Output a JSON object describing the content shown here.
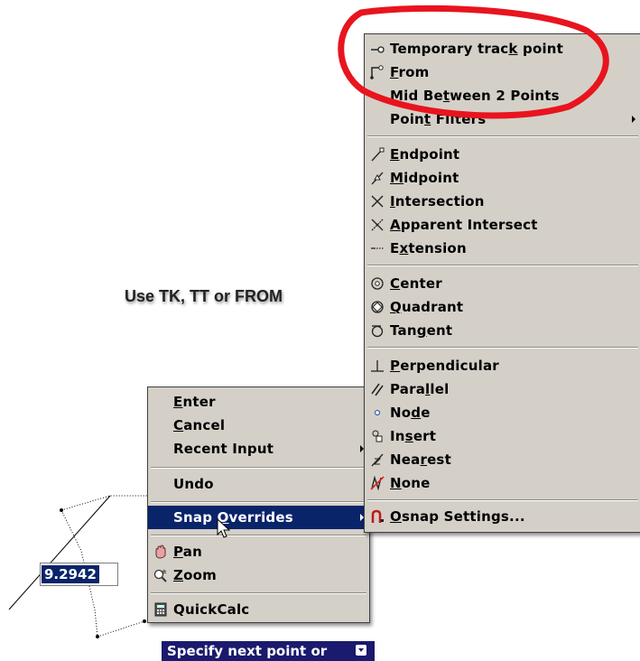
{
  "annotation": {
    "text": "Use TK, TT or FROM",
    "highlight_color": "#e8141e"
  },
  "dynamic_input": {
    "value": "9.2942"
  },
  "command_prompt": {
    "text": "Specify next point or"
  },
  "context_menu": {
    "items": {
      "enter": {
        "pre": "",
        "ul": "E",
        "post": "nter"
      },
      "cancel": {
        "pre": "",
        "ul": "C",
        "post": "ancel"
      },
      "recent_input": {
        "text": "Recent Input"
      },
      "undo": {
        "text": "Undo"
      },
      "snap_overrides": {
        "pre": "Snap ",
        "ul": "O",
        "post": "verrides"
      },
      "pan": {
        "pre": "",
        "ul": "P",
        "post": "an"
      },
      "zoom": {
        "pre": "",
        "ul": "Z",
        "post": "oom"
      },
      "quickcalc": {
        "text": "QuickCalc"
      }
    }
  },
  "snap_submenu": {
    "items": {
      "temporary_track": {
        "pre": "Temporary trac",
        "ul": "k",
        "post": " point"
      },
      "from": {
        "pre": "",
        "ul": "F",
        "post": "rom"
      },
      "mid_between": {
        "pre": "Mid Be",
        "ul": "t",
        "post": "ween 2 Points"
      },
      "point_filters": {
        "pre": "Poin",
        "ul": "t",
        "post": " Filters"
      },
      "endpoint": {
        "pre": "",
        "ul": "E",
        "post": "ndpoint"
      },
      "midpoint": {
        "pre": "",
        "ul": "M",
        "post": "idpoint"
      },
      "intersection": {
        "pre": "",
        "ul": "I",
        "post": "ntersection"
      },
      "apparent_intersect": {
        "pre": "",
        "ul": "A",
        "post": "pparent Intersect"
      },
      "extension": {
        "pre": "E",
        "ul": "x",
        "post": "tension"
      },
      "center": {
        "pre": "",
        "ul": "C",
        "post": "enter"
      },
      "quadrant": {
        "pre": "",
        "ul": "Q",
        "post": "uadrant"
      },
      "tangent": {
        "pre": "Tan",
        "ul": "g",
        "post": "ent"
      },
      "perpendicular": {
        "pre": "",
        "ul": "P",
        "post": "erpendicular"
      },
      "parallel": {
        "pre": "Para",
        "ul": "l",
        "post": "lel"
      },
      "node": {
        "pre": "No",
        "ul": "d",
        "post": "e"
      },
      "insert": {
        "pre": "In",
        "ul": "s",
        "post": "ert"
      },
      "nearest": {
        "pre": "Nea",
        "ul": "r",
        "post": "est"
      },
      "none": {
        "pre": "",
        "ul": "N",
        "post": "one"
      },
      "osnap_settings": {
        "pre": "",
        "ul": "O",
        "post": "snap Settings..."
      }
    }
  },
  "icons": {
    "temporary_track": "temporary-track-icon",
    "from": "from-icon",
    "endpoint": "endpoint-icon",
    "midpoint": "midpoint-icon",
    "intersection": "intersection-icon",
    "apparent_intersect": "apparent-intersect-icon",
    "extension": "extension-icon",
    "center": "center-icon",
    "quadrant": "quadrant-icon",
    "tangent": "tangent-icon",
    "perpendicular": "perpendicular-icon",
    "parallel": "parallel-icon",
    "node": "node-icon",
    "insert": "insert-icon",
    "nearest": "nearest-icon",
    "none": "none-icon",
    "osnap_settings": "osnap-settings-icon",
    "pan": "pan-icon",
    "zoom": "zoom-icon",
    "quickcalc": "calculator-icon"
  },
  "colors": {
    "menu_bg": "#d4d0c8",
    "selection": "#0a246a",
    "prompt_bg": "#1a1a6e"
  }
}
